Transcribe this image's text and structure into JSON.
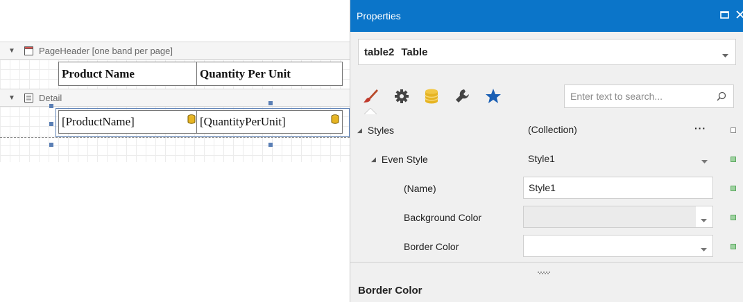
{
  "designer": {
    "page_header_band": {
      "label": "PageHeader [one band per page]",
      "icon": "page-header-band-icon"
    },
    "header_cells": [
      "Product Name",
      "Quantity Per Unit"
    ],
    "detail_band": {
      "label": "Detail",
      "icon": "detail-band-icon"
    },
    "detail_cells": [
      "[ProductName]",
      "[QuantityPerUnit]"
    ]
  },
  "properties": {
    "title": "Properties",
    "selected_object": {
      "name": "table2",
      "type": "Table"
    },
    "tabs": [
      "appearance-brush-icon",
      "behavior-gear-icon",
      "data-database-icon",
      "design-wrench-icon",
      "favorites-star-icon"
    ],
    "search_placeholder": "Enter text to search...",
    "rows": [
      {
        "name": "Styles",
        "value": "(Collection)"
      },
      {
        "name": "Even Style",
        "value": "Style1"
      },
      {
        "name": "(Name)",
        "value": "Style1"
      },
      {
        "name": "Background Color",
        "value": ""
      },
      {
        "name": "Border Color",
        "value": ""
      }
    ],
    "description_title": "Border Color"
  },
  "colors": {
    "title_bar": "#0b75c9",
    "handle": "#5a7fb5",
    "marker_green": "#9ed2a0",
    "brush_red": "#c0392b",
    "gear_dark": "#444444",
    "database_amber": "#e6b422",
    "star_blue": "#1a5fb4"
  }
}
